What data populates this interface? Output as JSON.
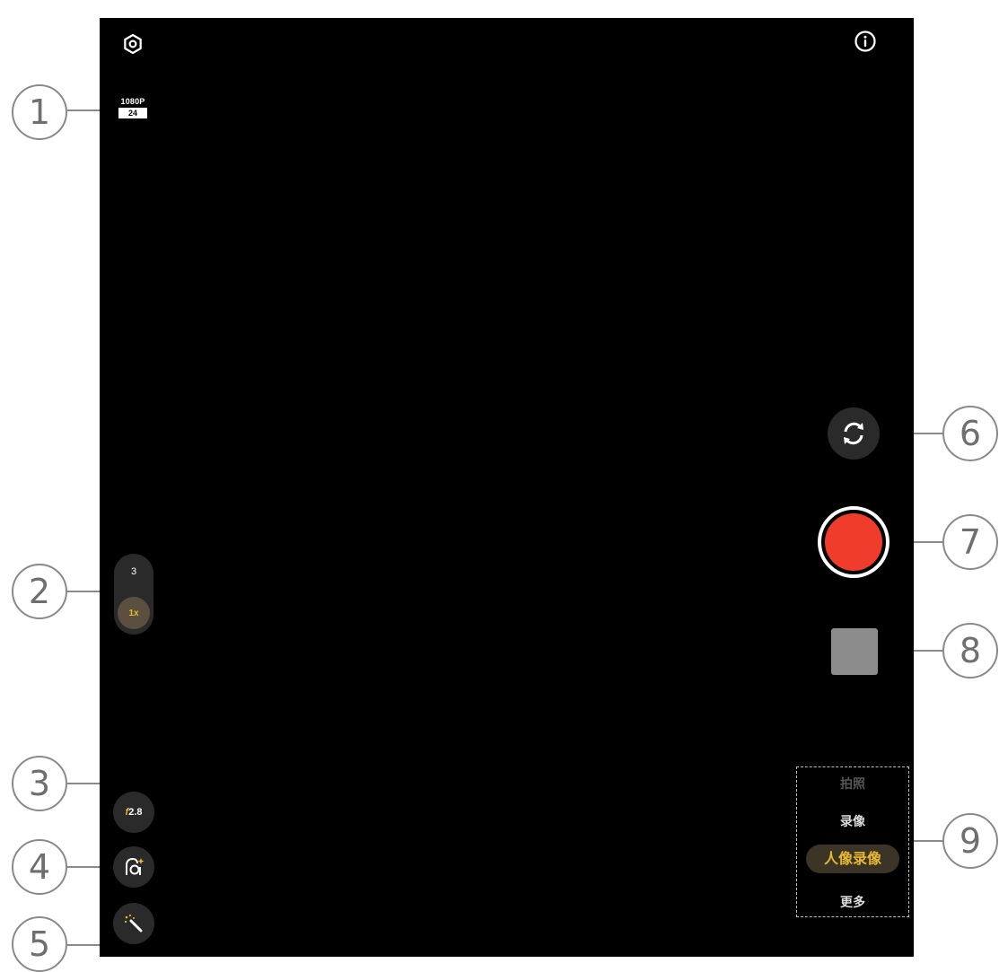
{
  "top_bar": {
    "settings_icon": "gear-icon",
    "info_icon": "info-icon"
  },
  "resolution": {
    "label": "1080P",
    "fps": "24"
  },
  "zoom": {
    "option_3": "3",
    "option_1x": "1x"
  },
  "aperture": {
    "value": "f2.8"
  },
  "portrait_light_icon": "portrait-lighting-icon",
  "beauty_icon": "magic-wand-icon",
  "switch_camera_icon": "switch-camera-icon",
  "record_button_color": "#f03d2b",
  "modes": {
    "items": [
      "拍照",
      "录像",
      "人像录像",
      "更多"
    ],
    "active": "人像录像"
  },
  "callouts": [
    "1",
    "2",
    "3",
    "4",
    "5",
    "6",
    "7",
    "8",
    "9"
  ]
}
